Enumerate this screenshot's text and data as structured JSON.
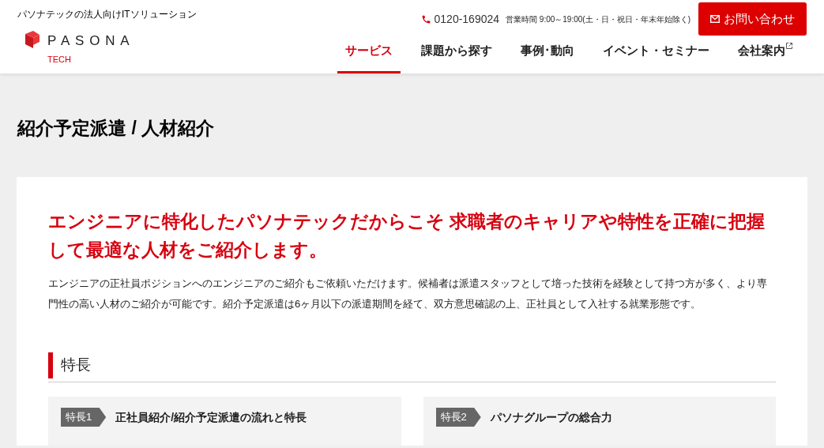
{
  "header": {
    "tagline": "パソナテックの法人向けITソリューション",
    "logo_main": "PASONA",
    "logo_sub": "TECH",
    "phone": "0120-169024",
    "hours": "営業時間 9:00～19:00(土・日・祝日・年末年始除く)",
    "contact_button": "お問い合わせ"
  },
  "nav": [
    {
      "label": "サービス",
      "selected": true,
      "external": false
    },
    {
      "label": "課題から探す",
      "selected": false,
      "external": false
    },
    {
      "label": "事例･動向",
      "selected": false,
      "external": false
    },
    {
      "label": "イベント・セミナー",
      "selected": false,
      "external": false
    },
    {
      "label": "会社案内",
      "selected": false,
      "external": true
    }
  ],
  "page_title": "紹介予定派遣 / 人材紹介",
  "lead": "エンジニアに特化したパソナテックだからこそ 求職者のキャリアや特性を正確に把握して最適な人材をご紹介します。",
  "body": "エンジニアの正社員ポジションへのエンジニアのご紹介もご依頼いただけます。候補者は派遣スタッフとして培った技術を経験として持つ方が多く、より専門性の高い人材のご紹介が可能です。紹介予定派遣は6ヶ月以下の派遣期間を経て、双方意思確認の上、正社員として入社する就業形態です。",
  "section_heading": "特長",
  "features": [
    {
      "tag": "特長1",
      "title": "正社員紹介/紹介予定派遣の流れと特長"
    },
    {
      "tag": "特長2",
      "title": "パソナグループの総合力"
    }
  ]
}
